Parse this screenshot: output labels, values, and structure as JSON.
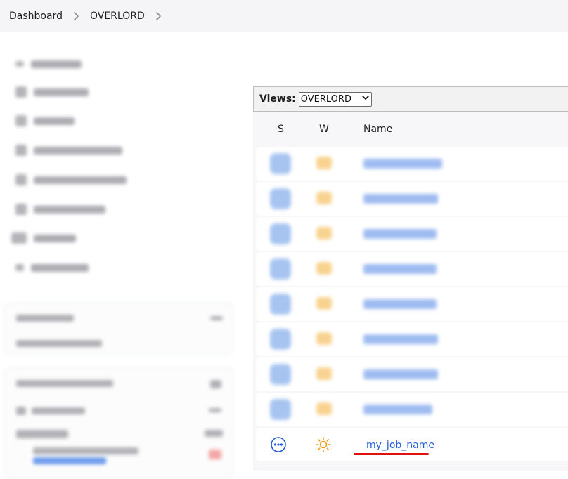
{
  "breadcrumb": {
    "items": [
      "Dashboard",
      "OVERLORD"
    ]
  },
  "views": {
    "label": "Views:",
    "selected": "OVERLORD"
  },
  "table": {
    "headers": [
      "S",
      "W",
      "Name"
    ],
    "visible_job": {
      "name": "my_job_name",
      "status_icon": "in-progress-ellipsis-icon",
      "weather_icon": "sunny-icon"
    }
  },
  "colors": {
    "accent_blue": "#1f5fdb",
    "weather_yellow": "#f29d1c",
    "highlight_red": "#e01010"
  }
}
